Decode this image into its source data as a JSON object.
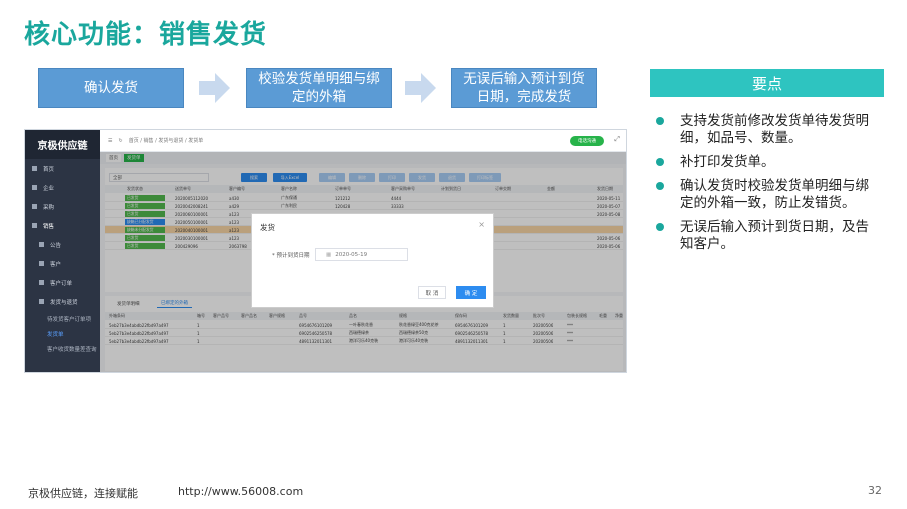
{
  "title": "核心功能：销售发货",
  "steps": [
    {
      "label": "确认发货"
    },
    {
      "label": "校验发货单明细与绑定的外箱"
    },
    {
      "label": "无误后输入预计到货日期，完成发货"
    }
  ],
  "key_points": {
    "heading": "要点",
    "items": [
      "支持发货前修改发货单待发货明细，如品号、数量。",
      "补打印发货单。",
      "确认发货时校验发货单明细与绑定的外箱一致，防止发错货。",
      "无误后输入预计到货日期，及告知客户。"
    ]
  },
  "footer": {
    "slogan": "京极供应链，连接赋能",
    "url": "http://www.56008.com",
    "page": "32"
  },
  "app": {
    "brand": "京极供应链",
    "breadcrumb": "首页 / 销售 / 发货与退货 / 发货单",
    "service_button": "电话沟通",
    "tabs": [
      "首页",
      "发货单"
    ],
    "sidebar": [
      {
        "label": "首页"
      },
      {
        "label": "企业"
      },
      {
        "label": "采购"
      },
      {
        "label": "销售"
      },
      {
        "label": "公告"
      },
      {
        "label": "客户"
      },
      {
        "label": "客户订单"
      },
      {
        "label": "发货与退货"
      }
    ],
    "sidebar_sub": [
      "待发货客户订单项",
      "发货单",
      "客户收货数量差查询"
    ],
    "search_value": "全部",
    "toolbar": [
      "搜索",
      "导入Excel",
      "编辑",
      "删除",
      "打印",
      "发货",
      "退货",
      "打印标签"
    ],
    "columns": [
      "发货状态",
      "送货单号",
      "客户编号",
      "客户名称",
      "订单单号",
      "客户采购单号",
      "计划到货日",
      "订单交期",
      "金额",
      "发货日期"
    ],
    "rows": [
      {
        "status": "已发货",
        "no": "2020005112020",
        "cust": "a430",
        "name": "广东保通",
        "order": "121212",
        "po": "4444",
        "date": "2020-05-11",
        "color": "#52b94e"
      },
      {
        "status": "已发货",
        "no": "2020042008241",
        "cust": "a429",
        "name": "广东利民",
        "order": "120428",
        "po": "33333",
        "date": "2020-05-07",
        "color": "#52b94e"
      },
      {
        "status": "已发货",
        "no": "2020060100001",
        "cust": "a123",
        "name": "",
        "order": "",
        "po": "",
        "date": "2020-05-08",
        "color": "#52b94e"
      },
      {
        "status": "缺箱已分配发货",
        "no": "2020050100001",
        "cust": "a123",
        "name": "",
        "order": "",
        "po": "",
        "date": "",
        "color": "#2d8cf0"
      },
      {
        "status": "缺箱未分配发货",
        "no": "2020040100001",
        "cust": "a123",
        "name": "",
        "order": "",
        "po": "",
        "date": "",
        "color": "#52b94e"
      },
      {
        "status": "已发货",
        "no": "2020030100001",
        "cust": "a123",
        "name": "",
        "order": "",
        "po": "",
        "date": "2020-05-06",
        "color": "#52b94e"
      },
      {
        "status": "已发货",
        "no": "200429096",
        "cust": "2063798",
        "name": "",
        "order": "",
        "po": "",
        "date": "2020-05-06",
        "color": "#52b94e"
      }
    ],
    "lower_tabs": [
      "发货单明细",
      "已绑定的外箱"
    ],
    "lower_columns": [
      "外箱条码",
      "箱号",
      "客户品号",
      "客户品名",
      "客户规格",
      "品号",
      "品名",
      "规格",
      "保存码",
      "发货数量",
      "批次号",
      "包装长规格",
      "毛重",
      "净重"
    ],
    "lower_rows": [
      {
        "code": "5eb27b3e4abdb22fbd97a497",
        "box": "1",
        "item": "6954676101209",
        "name": "一叶春秋花香",
        "spec": "秋花香绿豆400克花茶",
        "save": "6954676101209",
        "qty": "1",
        "batch": "20200506",
        "pack": "***"
      },
      {
        "code": "5eb27b3e4abdb22fbd97a497",
        "box": "1",
        "item": "6902546250578",
        "name": "西瑞德绿茶",
        "spec": "西瑞德绿茶50克",
        "save": "6902546250578",
        "qty": "1",
        "batch": "20200506",
        "pack": "***"
      },
      {
        "code": "5eb27b3e4abdb22fbd97a497",
        "box": "1",
        "item": "4891132011301",
        "name": "港洋可乐40克装",
        "spec": "港洋可乐40克装",
        "save": "4891132011301",
        "qty": "1",
        "batch": "20200506",
        "pack": "***"
      }
    ],
    "dialog": {
      "title": "发货",
      "label": "* 预计到货日期",
      "date_value": "2020-05-19",
      "cancel": "取 消",
      "ok": "确 定"
    }
  }
}
